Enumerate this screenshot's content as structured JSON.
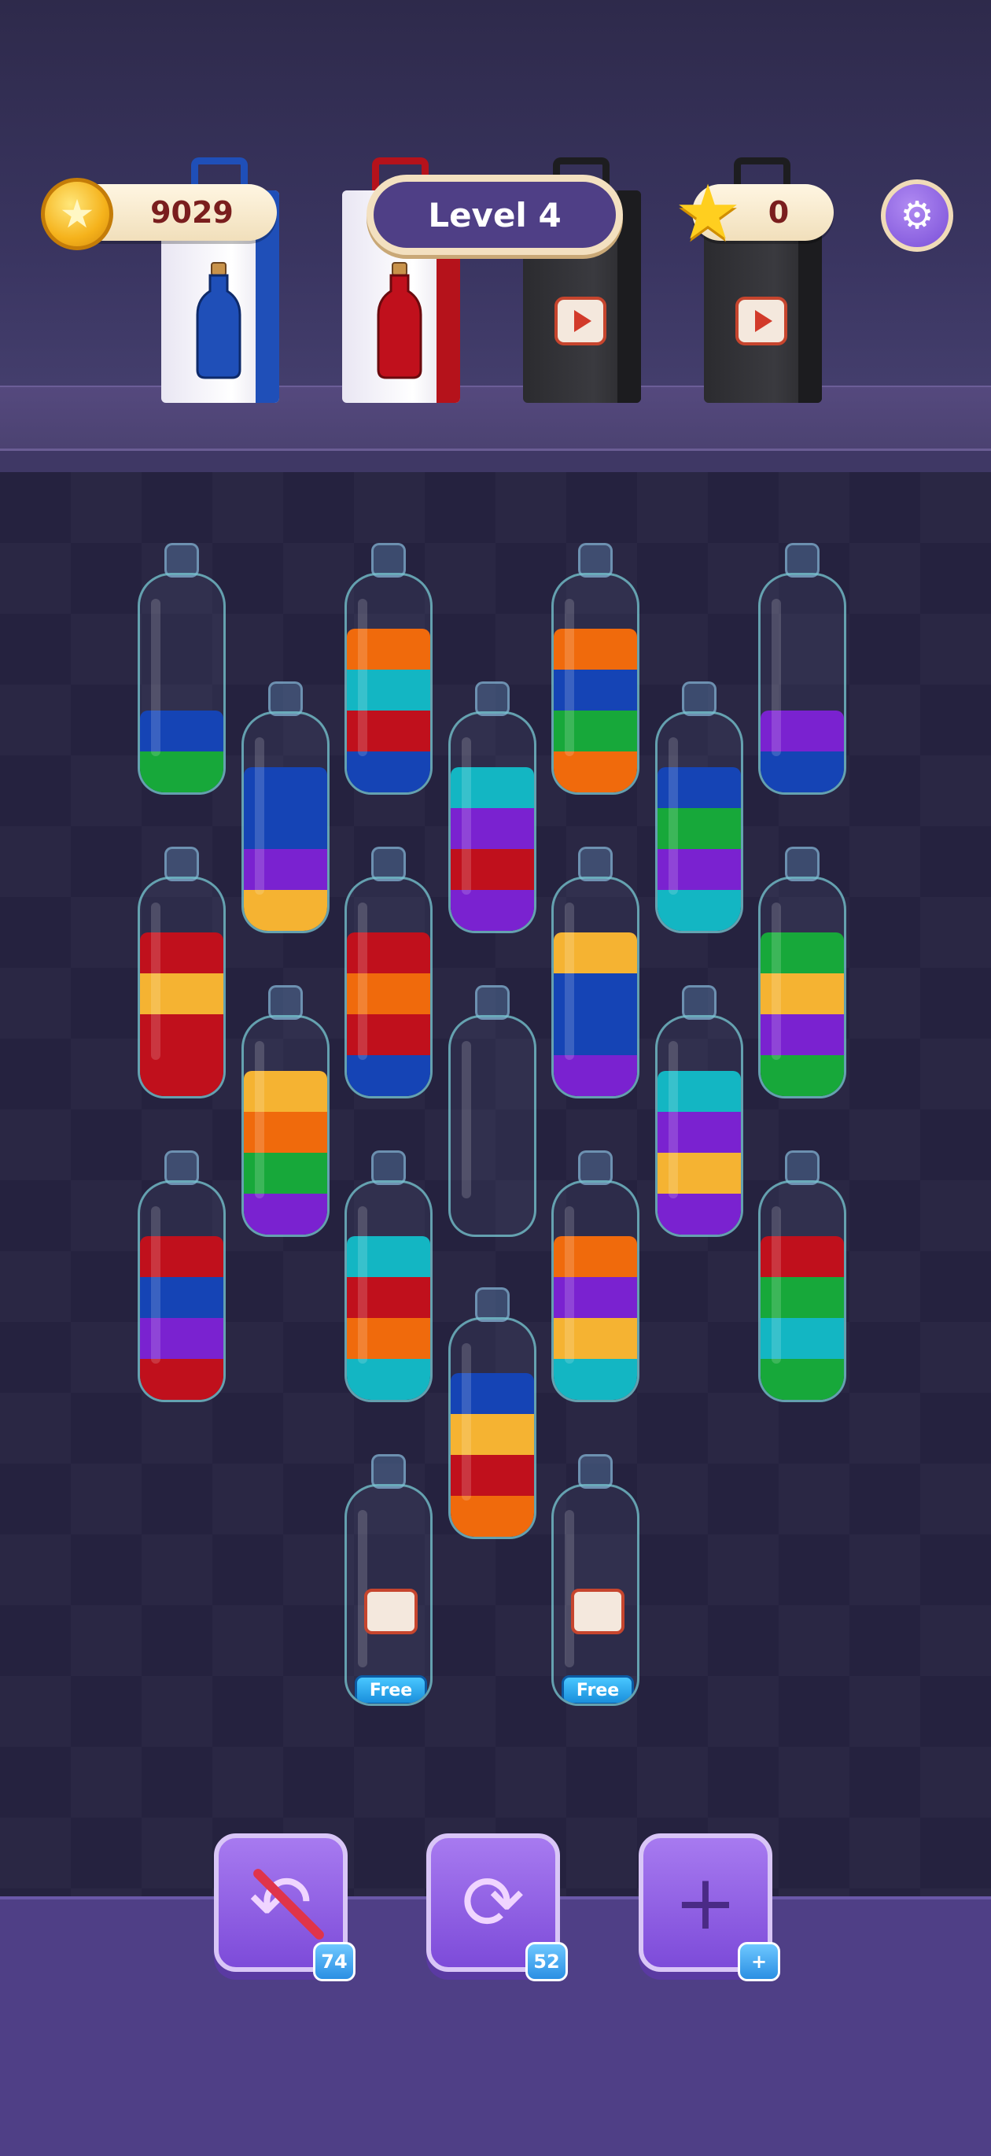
{
  "hud": {
    "coins": "9029",
    "coin_icon": "★",
    "level_label": "Level 4",
    "stars": "0",
    "star_icon": "★",
    "settings_icon": "⚙"
  },
  "bags": [
    {
      "name": "bag-blue-bottle",
      "style": "white",
      "accent": "#1f4fb8",
      "content": "blue-bottle"
    },
    {
      "name": "bag-red-bottle",
      "style": "white",
      "accent": "#b5121b",
      "content": "red-bottle"
    },
    {
      "name": "bag-video-locked-1",
      "style": "black",
      "accent": "#1d1d20",
      "content": "video"
    },
    {
      "name": "bag-video-locked-2",
      "style": "black",
      "accent": "#1d1d20",
      "content": "video"
    }
  ],
  "colors": {
    "blue": "#1544b5",
    "green": "#17a83a",
    "orange": "#f06a0c",
    "teal": "#13b6c3",
    "red": "#c0101c",
    "purple": "#7a22d0",
    "yellow": "#f5b332"
  },
  "bottles": [
    {
      "layers": [],
      "top_fill": [
        "blue",
        "green"
      ]
    },
    {
      "layers": [
        "blue",
        "blue",
        "purple",
        "yellow"
      ]
    },
    {
      "layers": [
        "orange",
        "teal",
        "red",
        "blue"
      ]
    },
    {
      "layers": [
        "teal",
        "purple",
        "red",
        "purple"
      ]
    },
    {
      "layers": [
        "orange",
        "blue",
        "green",
        "orange"
      ]
    },
    {
      "layers": [
        "blue",
        "green",
        "purple",
        "teal"
      ]
    },
    {
      "layers": [
        "purple",
        "blue"
      ]
    },
    {
      "layers": [
        "red",
        "yellow",
        "red",
        "red"
      ]
    },
    {
      "layers": [
        "red",
        "orange",
        "red",
        "blue"
      ]
    },
    {
      "layers": [
        "yellow",
        "blue",
        "blue",
        "purple"
      ]
    },
    {
      "layers": [
        "green",
        "yellow",
        "purple",
        "green"
      ]
    },
    {
      "layers": [
        "yellow",
        "orange",
        "green",
        "purple"
      ]
    },
    {
      "layers": []
    },
    {
      "layers": [
        "teal",
        "purple",
        "yellow",
        "purple"
      ]
    },
    {
      "layers": [
        "red",
        "blue",
        "purple",
        "red"
      ]
    },
    {
      "layers": [
        "teal",
        "red",
        "orange",
        "teal"
      ]
    },
    {
      "layers": [
        "orange",
        "purple",
        "yellow",
        "teal"
      ]
    },
    {
      "layers": [
        "red",
        "green",
        "teal",
        "green"
      ]
    },
    {
      "layers": [
        "blue",
        "yellow",
        "red",
        "orange"
      ]
    }
  ],
  "locked_bottles": [
    {
      "tag": "Free",
      "icon": "video-play-icon"
    },
    {
      "tag": "Free",
      "icon": "video-play-icon"
    }
  ],
  "tools": {
    "undo": {
      "icon": "↶",
      "count": "74"
    },
    "shuffle": {
      "icon": "⟳",
      "count": "52"
    },
    "add_bottle": {
      "icon": "+",
      "count": "+"
    }
  }
}
